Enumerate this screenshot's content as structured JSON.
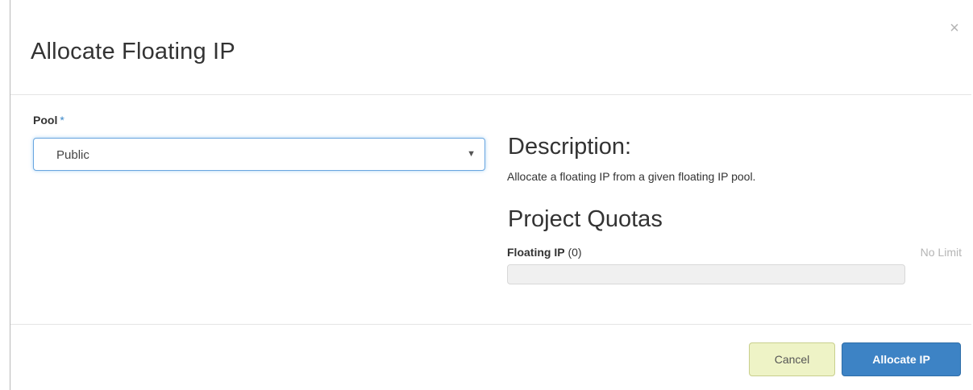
{
  "modal": {
    "title": "Allocate Floating IP",
    "close_label": "×"
  },
  "form": {
    "pool_label": "Pool",
    "required_mark": "*",
    "pool_selected": "Public"
  },
  "description": {
    "heading": "Description:",
    "text": "Allocate a floating IP from a given floating IP pool."
  },
  "quotas": {
    "heading": "Project Quotas",
    "item_label": "Floating IP",
    "item_count": "(0)",
    "limit_text": "No Limit",
    "usage_fraction": 0
  },
  "footer": {
    "cancel_label": "Cancel",
    "allocate_label": "Allocate IP"
  },
  "colors": {
    "primary": "#3d83c5",
    "cancel_bg": "#eef3c6",
    "focus_border": "#69a6e0"
  }
}
